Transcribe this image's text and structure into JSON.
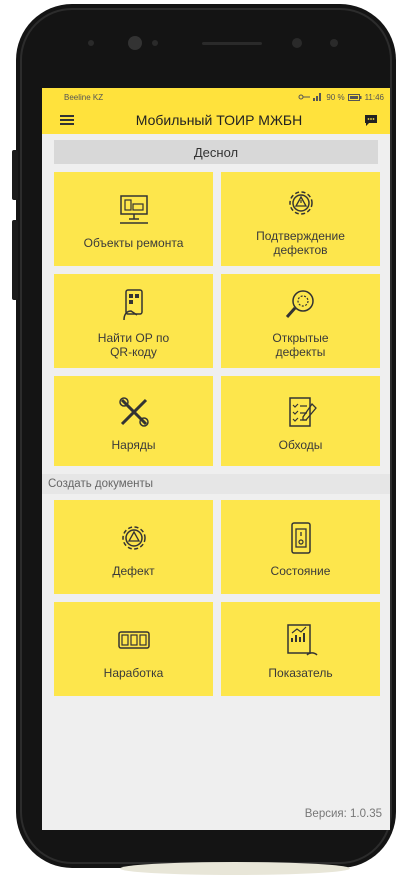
{
  "status_bar": {
    "carrier": "Beeline KZ",
    "right_text": "90 %",
    "time": "11:46"
  },
  "app_bar": {
    "title": "Мобильный ТОИР МЖБН"
  },
  "location": "Деснол",
  "main_tiles": [
    {
      "label": "Объекты ремонта",
      "icon": "monitor-icon"
    },
    {
      "label": "Подтверждение дефектов",
      "icon": "gear-warning-icon"
    },
    {
      "label": "Найти ОР по QR-коду",
      "icon": "qr-scan-icon"
    },
    {
      "label": "Открытые дефекты",
      "icon": "magnifier-gear-icon"
    },
    {
      "label": "Наряды",
      "icon": "tools-icon"
    },
    {
      "label": "Обходы",
      "icon": "checklist-icon"
    }
  ],
  "create_section": {
    "title": "Создать документы",
    "tiles": [
      {
        "label": "Дефект",
        "icon": "gear-warning-icon"
      },
      {
        "label": "Состояние",
        "icon": "switch-icon"
      },
      {
        "label": "Наработка",
        "icon": "counter-icon"
      },
      {
        "label": "Показатель",
        "icon": "report-icon"
      }
    ]
  },
  "version": "Версия: 1.0.35",
  "colors": {
    "accent": "#ffe23c",
    "tile": "#fde64c"
  }
}
